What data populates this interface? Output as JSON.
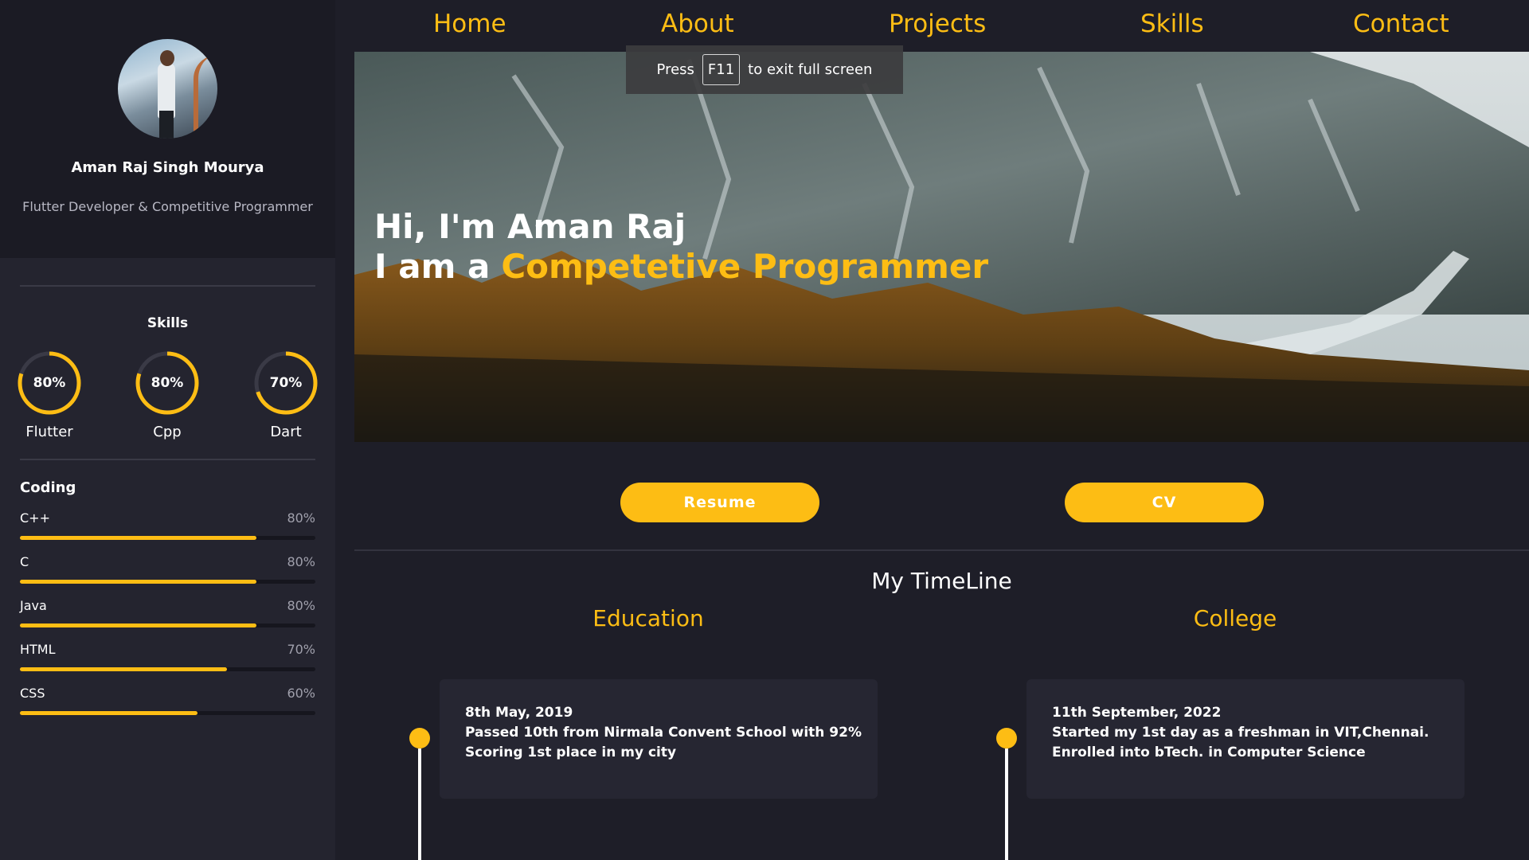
{
  "sidebar": {
    "name": "Aman Raj Singh Mourya",
    "role": "Flutter Developer & Competitive Programmer",
    "skills_title": "Skills",
    "rings": [
      {
        "label": "Flutter",
        "percent_text": "80%",
        "value": 0.8
      },
      {
        "label": "Cpp",
        "percent_text": "80%",
        "value": 0.8
      },
      {
        "label": "Dart",
        "percent_text": "70%",
        "value": 0.7
      }
    ],
    "coding_title": "Coding",
    "bars": [
      {
        "label": "C++",
        "value_text": "80%",
        "value": 0.8
      },
      {
        "label": "C",
        "value_text": "80%",
        "value": 0.8
      },
      {
        "label": "Java",
        "value_text": "80%",
        "value": 0.8
      },
      {
        "label": "HTML",
        "value_text": "70%",
        "value": 0.7
      },
      {
        "label": "CSS",
        "value_text": "60%",
        "value": 0.6
      }
    ]
  },
  "nav": {
    "items": [
      "Home",
      "About",
      "Projects",
      "Skills",
      "Contact"
    ]
  },
  "hero": {
    "greeting": "Hi, I'm Aman Raj",
    "prefix": "I am a",
    "title": "Competetive Programmer"
  },
  "fullscreen_notice": {
    "press": "Press",
    "key": "F11",
    "suffix": "to exit full screen"
  },
  "buttons": {
    "resume": "Resume",
    "cv": "CV"
  },
  "timeline": {
    "title": "My TimeLine",
    "columns": [
      {
        "heading": "Education",
        "date": "8th May, 2019",
        "line1": "Passed 10th from Nirmala Convent School with 92%",
        "line2": "Scoring 1st place in my city"
      },
      {
        "heading": "College",
        "date": "11th September, 2022",
        "line1": "Started my 1st day as a freshman in VIT,Chennai.",
        "line2": "Enrolled into bTech. in Computer Science"
      }
    ]
  },
  "colors": {
    "accent": "#fdbd14",
    "background": "#1e1e28",
    "sidebar": "#24242f"
  }
}
